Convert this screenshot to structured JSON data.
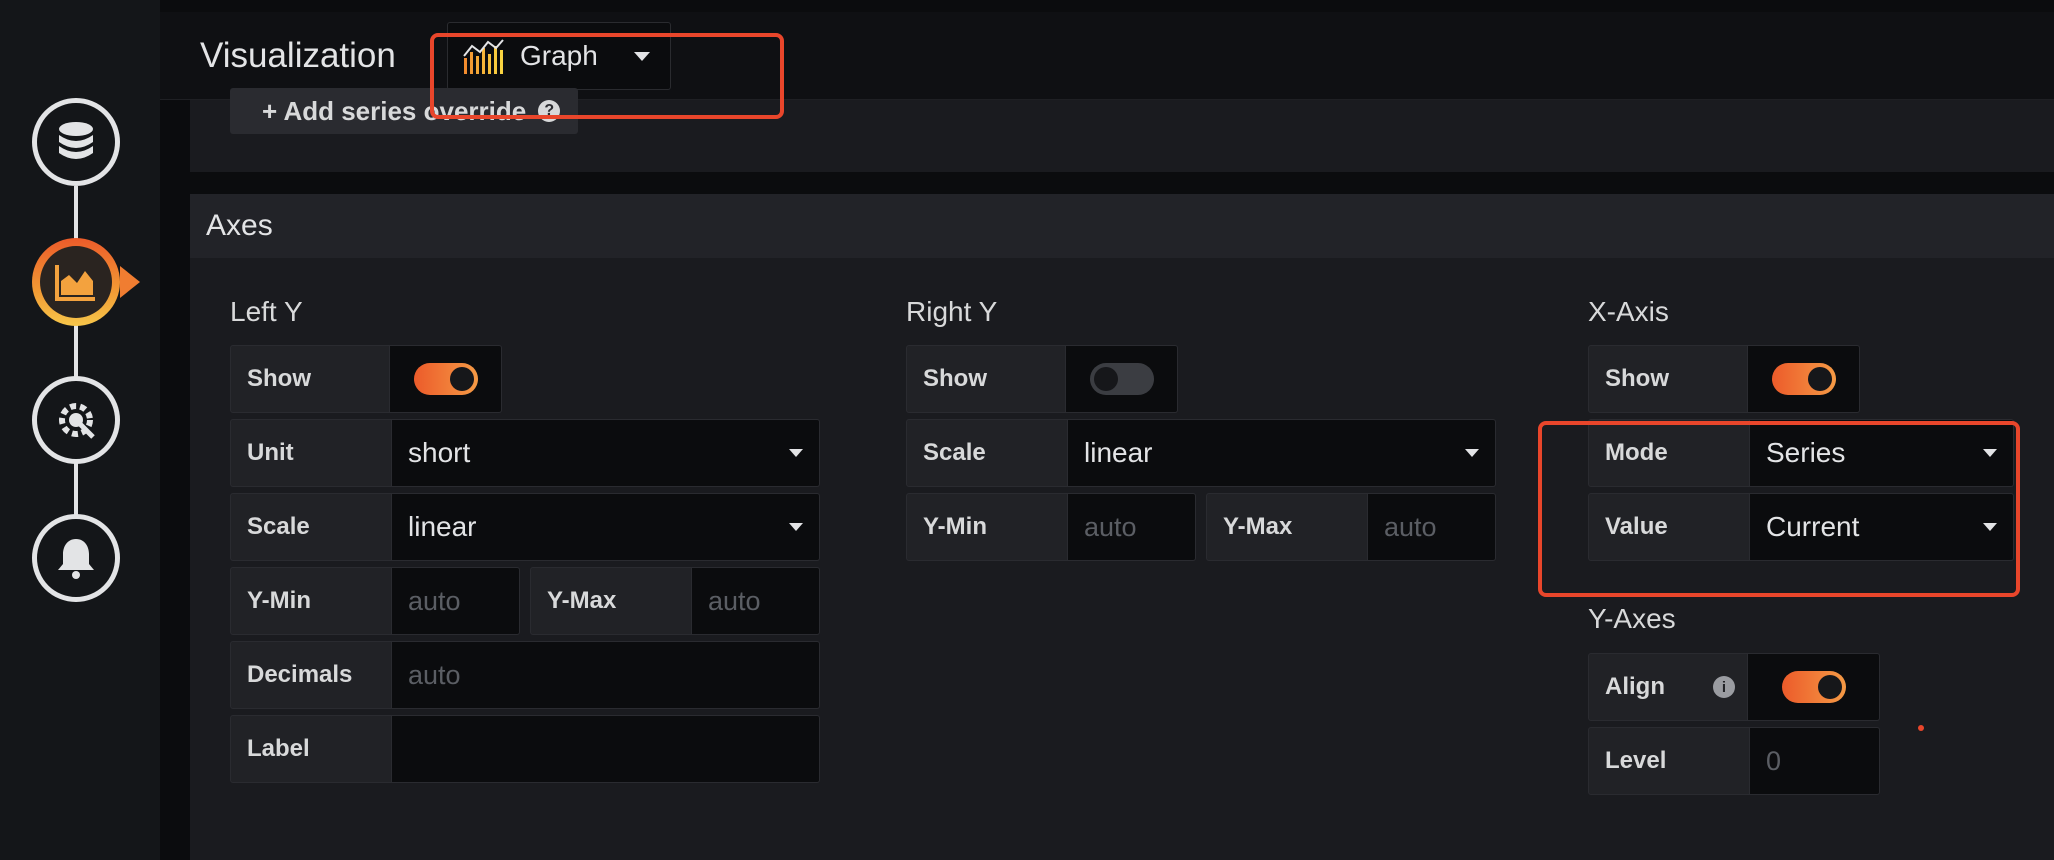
{
  "topbar": {
    "title": "Visualization",
    "picker": {
      "label": "Graph",
      "icon": "graph-bars-icon"
    }
  },
  "sidebar": {
    "steps": [
      {
        "name": "queries",
        "icon": "database-icon",
        "active": false
      },
      {
        "name": "visualization",
        "icon": "area-chart-icon",
        "active": true
      },
      {
        "name": "general",
        "icon": "settings-wrench-icon",
        "active": false
      },
      {
        "name": "alert",
        "icon": "bell-icon",
        "active": false
      }
    ]
  },
  "series_override": {
    "label": "+ Add series override",
    "help_icon": "question-icon"
  },
  "axes": {
    "header": "Axes",
    "left_y": {
      "title": "Left Y",
      "show_label": "Show",
      "show": true,
      "unit_label": "Unit",
      "unit": "short",
      "scale_label": "Scale",
      "scale": "linear",
      "ymin_label": "Y-Min",
      "ymin_placeholder": "auto",
      "ymax_label": "Y-Max",
      "ymax_placeholder": "auto",
      "decimals_label": "Decimals",
      "decimals_placeholder": "auto",
      "label_label": "Label",
      "label_value": ""
    },
    "right_y": {
      "title": "Right Y",
      "show_label": "Show",
      "show": false,
      "scale_label": "Scale",
      "scale": "linear",
      "ymin_label": "Y-Min",
      "ymin_placeholder": "auto",
      "ymax_label": "Y-Max",
      "ymax_placeholder": "auto"
    },
    "x_axis": {
      "title": "X-Axis",
      "show_label": "Show",
      "show": true,
      "mode_label": "Mode",
      "mode": "Series",
      "value_label": "Value",
      "value": "Current"
    },
    "y_axes": {
      "title": "Y-Axes",
      "align_label": "Align",
      "align": true,
      "align_info_icon": "info-icon",
      "level_label": "Level",
      "level_placeholder": "0"
    }
  },
  "colors": {
    "accent": "#f07d31",
    "highlight": "#e9462b",
    "panel": "#1a1b1f",
    "background": "#0b0c0e"
  }
}
